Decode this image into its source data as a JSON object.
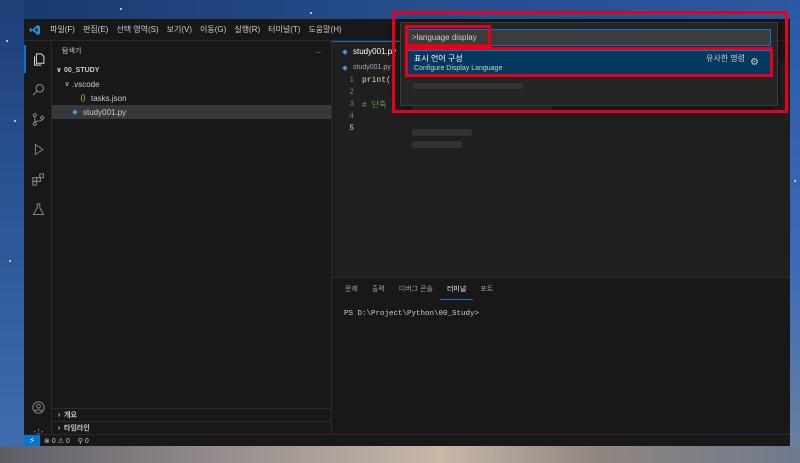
{
  "menu": {
    "items": [
      "파일(F)",
      "편집(E)",
      "선택 영역(S)",
      "보기(V)",
      "이동(G)",
      "실행(R)",
      "터미널(T)",
      "도움말(H)"
    ]
  },
  "sidebar": {
    "title": "탐색기",
    "more": "...",
    "tree": [
      {
        "label": "00_STUDY",
        "indent": 0,
        "chevron": "∨",
        "icon": ""
      },
      {
        "label": ".vscode",
        "indent": 1,
        "chevron": "∨",
        "icon": ""
      },
      {
        "label": "tasks.json",
        "indent": 2,
        "chevron": "",
        "icon": "{}"
      },
      {
        "label": "study001.py",
        "indent": 1,
        "chevron": "",
        "icon": "◆"
      }
    ],
    "sections": [
      "개요",
      "타임라인"
    ]
  },
  "editor": {
    "tab_label": "study001.py",
    "breadcrumb": "study001.py",
    "lines": [
      {
        "num": "1",
        "text": "print("
      },
      {
        "num": "2",
        "text": ""
      },
      {
        "num": "3",
        "text": "# 단축"
      },
      {
        "num": "4",
        "text": ""
      },
      {
        "num": "5",
        "text": ""
      }
    ]
  },
  "panel": {
    "tabs": [
      "문제",
      "출력",
      "디버그 콘솔",
      "터미널",
      "포트"
    ],
    "active_tab": "터미널",
    "terminal_prompt": "PS D:\\Project\\Python\\00_Study>"
  },
  "statusbar": {
    "remote_icon": "⚡",
    "problems": "⊗ 0 ⚠ 0",
    "ports": "⚲ 0"
  },
  "palette": {
    "input_value": ">language display",
    "result_title": "표시 언어 구성",
    "result_subtitle": "Configure Display Language",
    "result_tag": "유사한 명령",
    "gear": "⚙"
  }
}
